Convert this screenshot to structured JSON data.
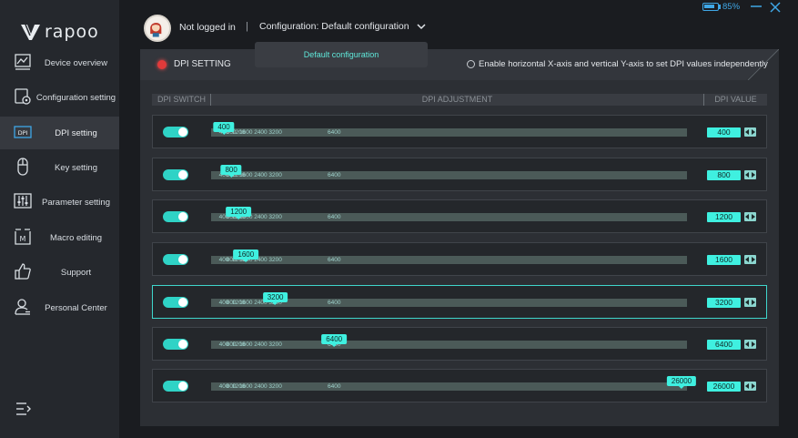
{
  "logo": {
    "text": "rapoo"
  },
  "sidebar": {
    "items": [
      {
        "label": "Device overview",
        "icon": "chart-icon"
      },
      {
        "label": "Configuration setting",
        "icon": "config-icon"
      },
      {
        "label": "DPI setting",
        "icon": "dpi-icon"
      },
      {
        "label": "Key setting",
        "icon": "mouse-icon"
      },
      {
        "label": "Parameter setting",
        "icon": "sliders-icon"
      },
      {
        "label": "Macro editing",
        "icon": "macro-icon"
      },
      {
        "label": "Support",
        "icon": "thumbs-up-icon"
      },
      {
        "label": "Personal Center",
        "icon": "user-icon"
      }
    ],
    "active_index": 2
  },
  "header": {
    "login_status": "Not logged in",
    "separator": "|",
    "config_label": "Configuration: Default configuration",
    "battery_percent": "85%",
    "battery_level": 0.85
  },
  "dropdown": {
    "option": "Default configuration"
  },
  "panel": {
    "title": "DPI SETTING",
    "independent_xy_label": "Enable horizontal X-axis and vertical Y-axis to set DPI values independently",
    "columns": {
      "switch": "DPI SWITCH",
      "adjust": "DPI ADJUSTMENT",
      "value": "DPI VALUE"
    }
  },
  "dpi_scale": {
    "min": 100,
    "max": 26000
  },
  "ticks": [
    "400",
    "800",
    "1200",
    "1600",
    "2400",
    "3200",
    "6400"
  ],
  "dpi_rows": [
    {
      "value": "400",
      "enabled": true,
      "selected": false
    },
    {
      "value": "800",
      "enabled": true,
      "selected": false
    },
    {
      "value": "1200",
      "enabled": true,
      "selected": false
    },
    {
      "value": "1600",
      "enabled": true,
      "selected": false
    },
    {
      "value": "3200",
      "enabled": true,
      "selected": true
    },
    {
      "value": "6400",
      "enabled": true,
      "selected": false
    },
    {
      "value": "26000",
      "enabled": true,
      "selected": false
    }
  ],
  "colors": {
    "accent": "#3ff0e0",
    "active_dot": "#e23a3a",
    "battery": "#3fa7e6"
  }
}
